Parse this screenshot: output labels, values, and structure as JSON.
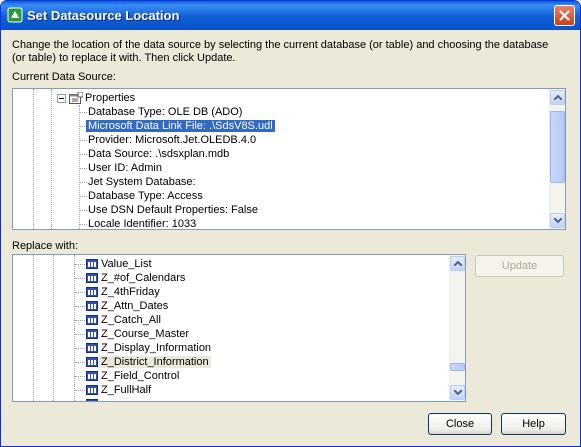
{
  "window": {
    "title": "Set Datasource Location",
    "accent": "#0a5fd8"
  },
  "description": "Change the location of the data source by selecting the current database (or table) and choosing the database (or table) to replace it with.  Then click Update.",
  "current": {
    "label": "Current Data Source:",
    "group_label": "Properties",
    "items": [
      "Database Type: OLE DB (ADO)",
      "Microsoft Data Link File: .\\SdsV8S.udl",
      "Provider: Microsoft.Jet.OLEDB.4.0",
      "Data Source: .\\sdsxplan.mdb",
      "User ID: Admin",
      "Jet System Database:",
      "Database Type: Access",
      "Use DSN Default Properties: False",
      "Locale Identifier: 1033"
    ],
    "selected_index": 1
  },
  "replace": {
    "label": "Replace with:",
    "items": [
      "Value_List",
      "Z_#of_Calendars",
      "Z_4thFriday",
      "Z_Attn_Dates",
      "Z_Catch_All",
      "Z_Course_Master",
      "Z_Display_Information",
      "Z_District_Information",
      "Z_Field_Control",
      "Z_FullHalf"
    ],
    "highlighted_index": 7,
    "update_label": "Update"
  },
  "buttons": {
    "close": "Close",
    "help": "Help"
  }
}
